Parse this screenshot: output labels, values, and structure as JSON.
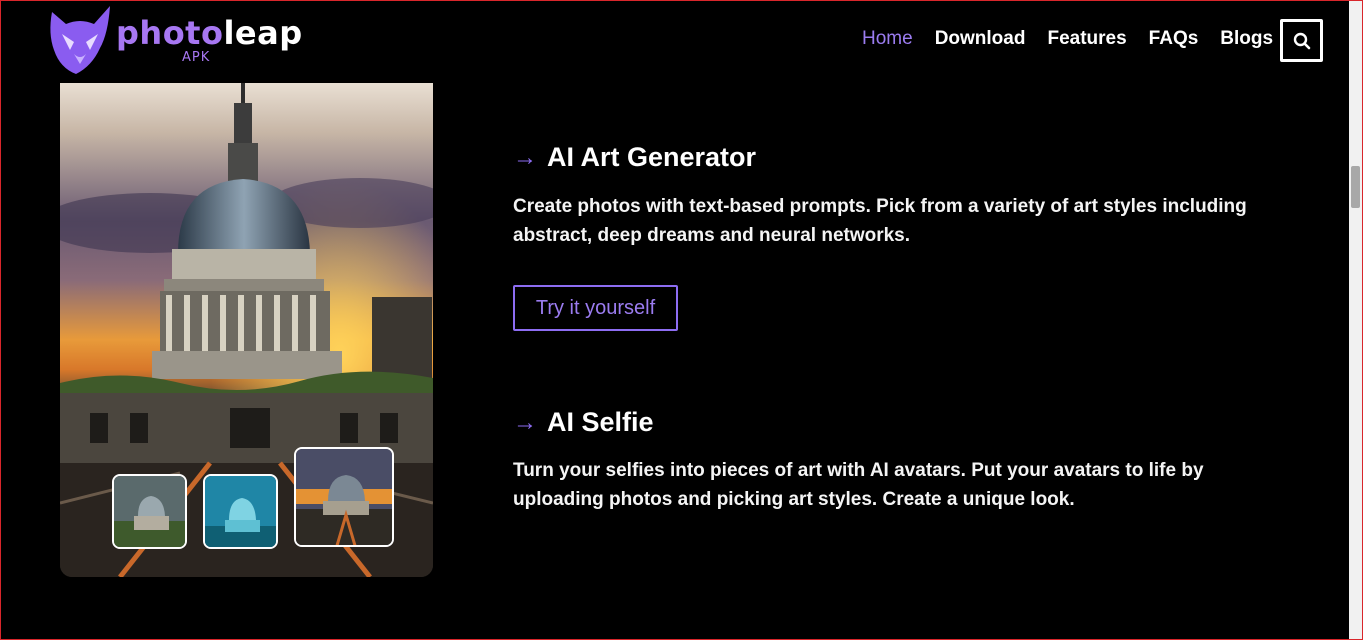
{
  "brand": {
    "word_purple": "photo",
    "word_white": "leap",
    "sub": "APK"
  },
  "nav": {
    "items": [
      {
        "label": "Home",
        "active": true
      },
      {
        "label": "Download",
        "active": false
      },
      {
        "label": "Features",
        "active": false
      },
      {
        "label": "FAQs",
        "active": false
      },
      {
        "label": "Blogs",
        "active": false
      }
    ],
    "search_icon": "search-icon"
  },
  "sections": [
    {
      "title": "AI Art Generator",
      "description": "Create photos with text-based prompts. Pick from a variety of art styles including abstract, deep dreams and neural networks.",
      "button_label": "Try it yourself"
    },
    {
      "title": "AI Selfie",
      "description": "Turn your selfies into pieces of art with AI avatars. Put your avatars to life by uploading photos and picking art styles.  Create a unique look."
    }
  ],
  "colors": {
    "accent": "#8d6df2",
    "background": "#000000",
    "text": "#ffffff"
  }
}
